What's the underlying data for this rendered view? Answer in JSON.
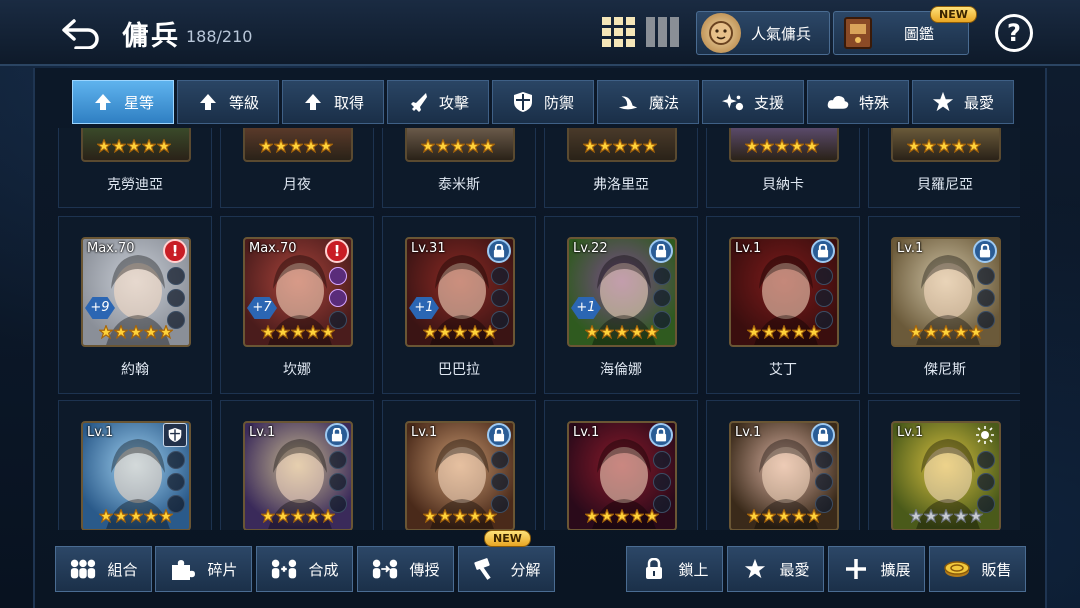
{
  "header": {
    "title": "傭兵",
    "count": "188/210",
    "popular_label": "人氣傭兵",
    "codex_label": "圖鑑",
    "codex_badge": "NEW",
    "help_label": "?"
  },
  "sort_tabs": [
    {
      "label": "星等",
      "icon": "up-arrow-icon",
      "active": true
    },
    {
      "label": "等級",
      "icon": "up-arrow-icon",
      "active": false
    },
    {
      "label": "取得",
      "icon": "up-arrow-icon",
      "active": false
    },
    {
      "label": "攻擊",
      "icon": "sword-icon",
      "active": false
    },
    {
      "label": "防禦",
      "icon": "shield-icon",
      "active": false
    },
    {
      "label": "魔法",
      "icon": "witch-hat-icon",
      "active": false
    },
    {
      "label": "支援",
      "icon": "sparkle-icon",
      "active": false
    },
    {
      "label": "特殊",
      "icon": "cloud-icon",
      "active": false
    },
    {
      "label": "最愛",
      "icon": "star-icon",
      "active": false
    }
  ],
  "top_row": [
    "克勞迪亞",
    "月夜",
    "泰米斯",
    "弗洛里亞",
    "貝納卡",
    "貝羅尼亞"
  ],
  "row2": [
    {
      "name": "約翰",
      "level": "Max.70",
      "badge": "alert",
      "plus": "+9",
      "stars": 5,
      "colors": [
        "#8a8f98",
        "#c9ced6"
      ]
    },
    {
      "name": "坎娜",
      "level": "Max.70",
      "badge": "alert",
      "plus": "+7",
      "stars": 5,
      "colors": [
        "#4a1c1c",
        "#a8433a"
      ],
      "slots_on": true
    },
    {
      "name": "巴巴拉",
      "level": "Lv.31",
      "badge": "lock",
      "plus": "+1",
      "stars": 5,
      "colors": [
        "#3a1414",
        "#8d2a24"
      ]
    },
    {
      "name": "海倫娜",
      "level": "Lv.22",
      "badge": "lock",
      "plus": "+1",
      "stars": 5,
      "colors": [
        "#2f5a1f",
        "#7a4b8a"
      ]
    },
    {
      "name": "艾丁",
      "level": "Lv.1",
      "badge": "lock",
      "plus": "",
      "stars": 5,
      "colors": [
        "#3a0e0e",
        "#7e1b1b"
      ]
    },
    {
      "name": "傑尼斯",
      "level": "Lv.1",
      "badge": "lock",
      "plus": "",
      "stars": 5,
      "colors": [
        "#6b5a3a",
        "#cfc3a5"
      ]
    }
  ],
  "row3": [
    {
      "level": "Lv.1",
      "badge": "shield",
      "stars": 5,
      "colors": [
        "#2a5a8a",
        "#9fd0f0"
      ]
    },
    {
      "level": "Lv.1",
      "badge": "lock",
      "stars": 5,
      "colors": [
        "#3a2a5a",
        "#c8b890"
      ]
    },
    {
      "level": "Lv.1",
      "badge": "lock",
      "stars": 5,
      "colors": [
        "#4a2a1a",
        "#c89870"
      ]
    },
    {
      "level": "Lv.1",
      "badge": "lock",
      "stars": 5,
      "colors": [
        "#2a0a1a",
        "#8a1a2a"
      ]
    },
    {
      "level": "Lv.1",
      "badge": "lock",
      "stars": 5,
      "colors": [
        "#3a2a1a",
        "#d8b0a0"
      ]
    },
    {
      "level": "Lv.1",
      "badge": "sun",
      "stars": 0,
      "colors": [
        "#4a5a1a",
        "#d8c040"
      ]
    }
  ],
  "bottom_left": [
    {
      "label": "組合",
      "icon": "team-icon"
    },
    {
      "label": "碎片",
      "icon": "puzzle-icon"
    },
    {
      "label": "合成",
      "icon": "merge-icon"
    },
    {
      "label": "傳授",
      "icon": "transfer-icon"
    },
    {
      "label": "分解",
      "icon": "hammer-icon",
      "badge": "NEW"
    }
  ],
  "bottom_right": [
    {
      "label": "鎖上",
      "icon": "lock-icon"
    },
    {
      "label": "最愛",
      "icon": "star-icon"
    },
    {
      "label": "擴展",
      "icon": "plus-icon"
    },
    {
      "label": "販售",
      "icon": "coin-icon"
    }
  ]
}
